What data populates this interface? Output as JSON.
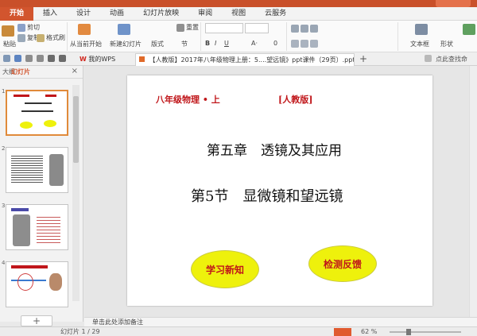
{
  "menu": {
    "tabs": [
      {
        "label": "开始"
      },
      {
        "label": "插入"
      },
      {
        "label": "设计"
      },
      {
        "label": "动画"
      },
      {
        "label": "幻灯片放映"
      },
      {
        "label": "审阅"
      },
      {
        "label": "视图"
      },
      {
        "label": "云服务"
      }
    ]
  },
  "ribbon": {
    "cut": "剪切",
    "copy": "复制",
    "format_painter": "格式刷",
    "paste": "粘贴",
    "from_current": "从当前开始",
    "new_slide": "新建幻灯片",
    "layout": "版式",
    "section": "节",
    "reset": "重置",
    "font_size": "0",
    "textbox": "文本框",
    "shape": "形状"
  },
  "tabs": {
    "wps": "我的WPS",
    "doc": "【人教版】2017年八年级物理上册：5....望远镜》ppt课件（29页）.ppt *",
    "search_hint": "点此查找命"
  },
  "panel": {
    "tab_outline": "大纲",
    "tab_slides": "幻灯片",
    "thumbnails": [
      {
        "num": "1"
      },
      {
        "num": "2"
      },
      {
        "num": "3"
      },
      {
        "num": "4"
      }
    ]
  },
  "slide": {
    "grade": "八年级物理 • 上",
    "edition": "[人教版]",
    "chapter": "第五章　透镜及其应用",
    "section": "第5节　显微镜和望远镜",
    "learn": "学习新知",
    "check": "检测反馈"
  },
  "notes": {
    "placeholder": "单击此处添加备注"
  },
  "status": {
    "slide_counter": "幻灯片 1 / 29",
    "zoom": "62 %",
    "zoom_fraction": 0.62
  },
  "colors": {
    "accent": "#d2552e",
    "slide_red": "#c0161a",
    "oval_yellow": "#eef10c"
  }
}
